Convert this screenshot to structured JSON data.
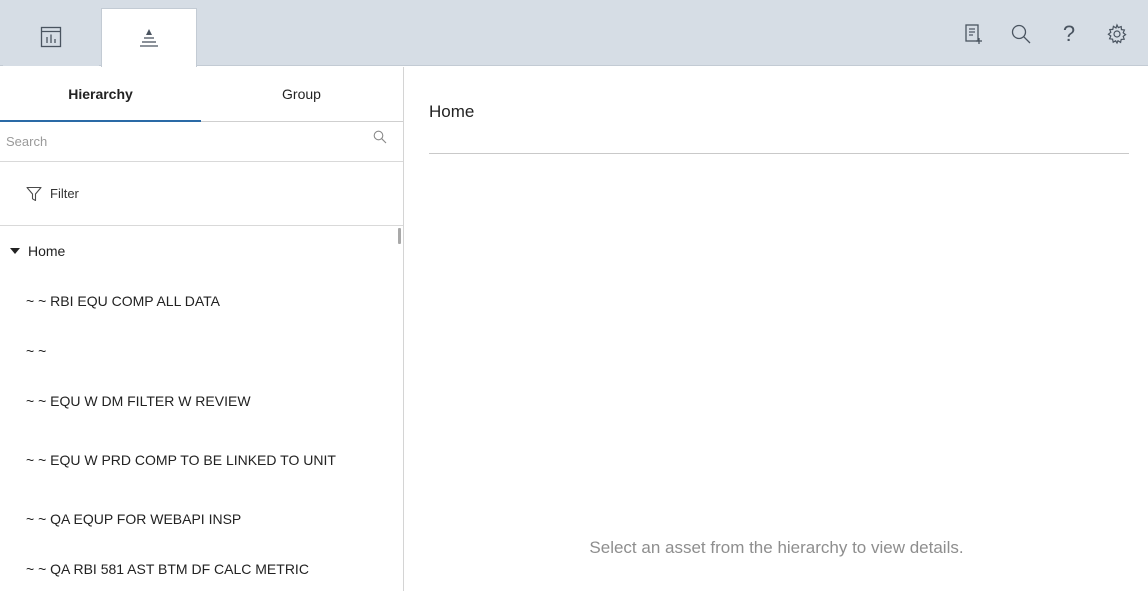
{
  "topbar": {
    "app_tabs": [
      {
        "icon": "dashboard-icon",
        "active": false
      },
      {
        "icon": "hierarchy-icon",
        "active": true
      }
    ],
    "actions": [
      {
        "icon": "add-note-icon"
      },
      {
        "icon": "search-icon"
      },
      {
        "icon": "help-icon",
        "glyph": "?"
      },
      {
        "icon": "settings-icon"
      }
    ]
  },
  "sidebar": {
    "tabs": [
      {
        "label": "Hierarchy",
        "selected": true
      },
      {
        "label": "Group",
        "selected": false
      }
    ],
    "search": {
      "placeholder": "Search",
      "value": ""
    },
    "filter": {
      "label": "Filter"
    },
    "tree": {
      "root": {
        "label": "Home",
        "expanded": true
      },
      "items": [
        "~ ~ RBI EQU COMP ALL DATA",
        "~ ~",
        "~ ~ EQU W DM FILTER W REVIEW",
        "~ ~ EQU W PRD COMP TO BE LINKED TO UNIT",
        "~ ~ QA EQUP FOR WEBAPI INSP",
        "~ ~ QA RBI 581 AST BTM DF CALC METRIC"
      ]
    }
  },
  "main": {
    "title": "Home",
    "empty_message": "Select an asset from the hierarchy to view details."
  },
  "colors": {
    "topbar_bg": "#d6dde5",
    "accent": "#2a6aa6",
    "icon": "#4a5460"
  }
}
